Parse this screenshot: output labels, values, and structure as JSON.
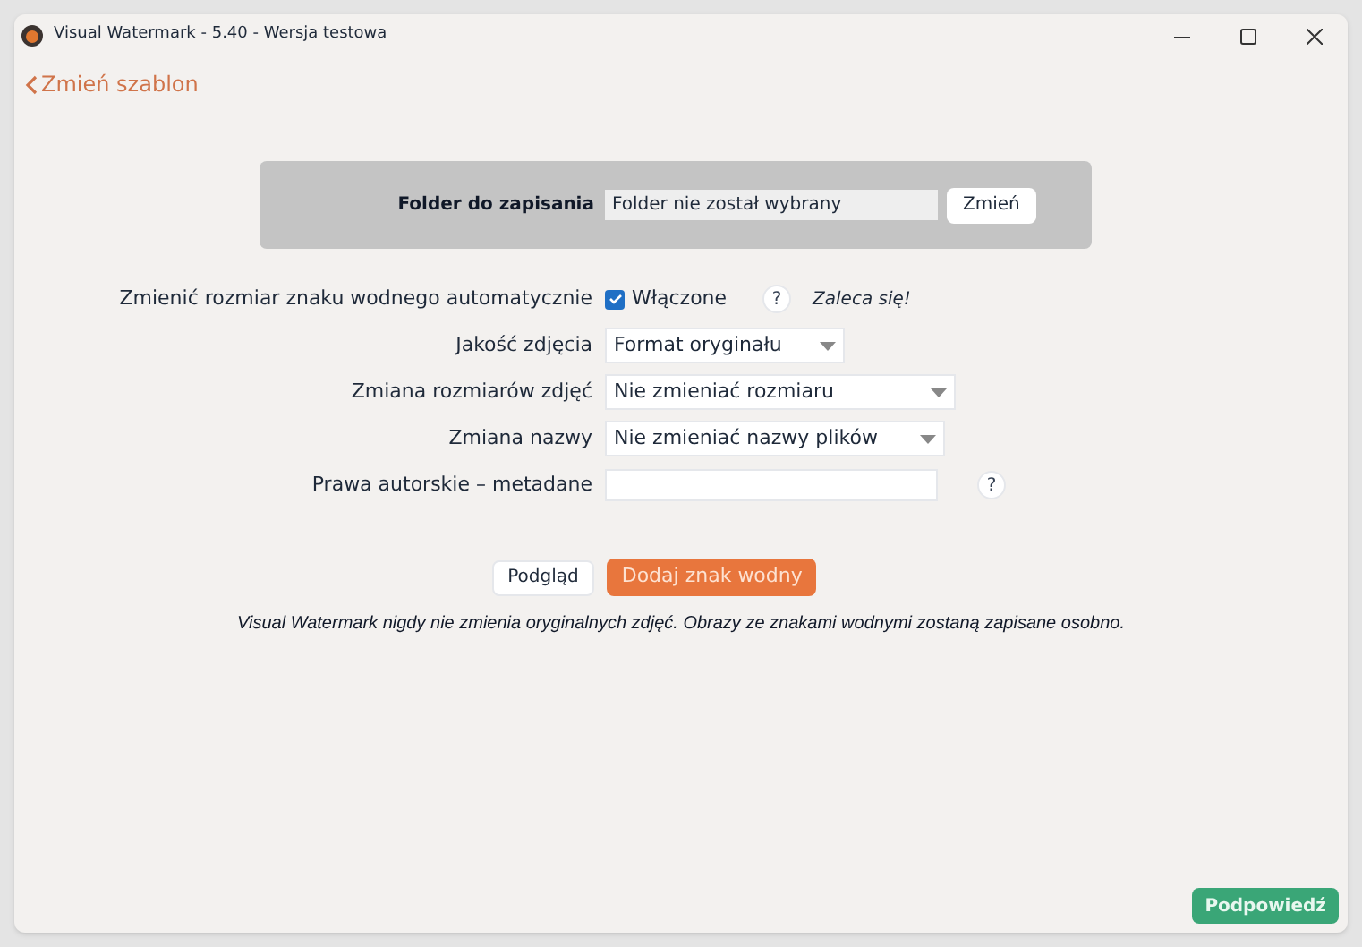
{
  "window": {
    "title": "Visual Watermark - 5.40 - Wersja testowa"
  },
  "back_link": "Zmień szablon",
  "folder": {
    "label": "Folder do zapisania",
    "value": "Folder nie został wybrany",
    "button": "Zmień"
  },
  "fields": [
    {
      "kind": "checkbox",
      "label": "Zmienić rozmiar znaku wodnego automatycznie",
      "option": "Włączone",
      "checked": true,
      "help": "?",
      "note": "Zaleca się!"
    },
    {
      "kind": "select",
      "label": "Jakość zdjęcia",
      "value": "Format oryginału"
    },
    {
      "kind": "select",
      "label": "Zmiana rozmiarów zdjęć",
      "value": "Nie zmieniać rozmiaru"
    },
    {
      "kind": "select",
      "label": "Zmiana nazwy",
      "value": "Nie zmieniać nazwy plików"
    },
    {
      "kind": "text",
      "label": "Prawa autorskie – metadane",
      "help": "?"
    }
  ],
  "buttons": {
    "preview": "Podgląd",
    "add": "Dodaj znak wodny"
  },
  "notice": "Visual Watermark nigdy nie zmienia oryginalnych zdjęć. Obrazy ze znakami wodnymi zostaną zapisane osobno.",
  "hint_button": "Podpowiedź"
}
